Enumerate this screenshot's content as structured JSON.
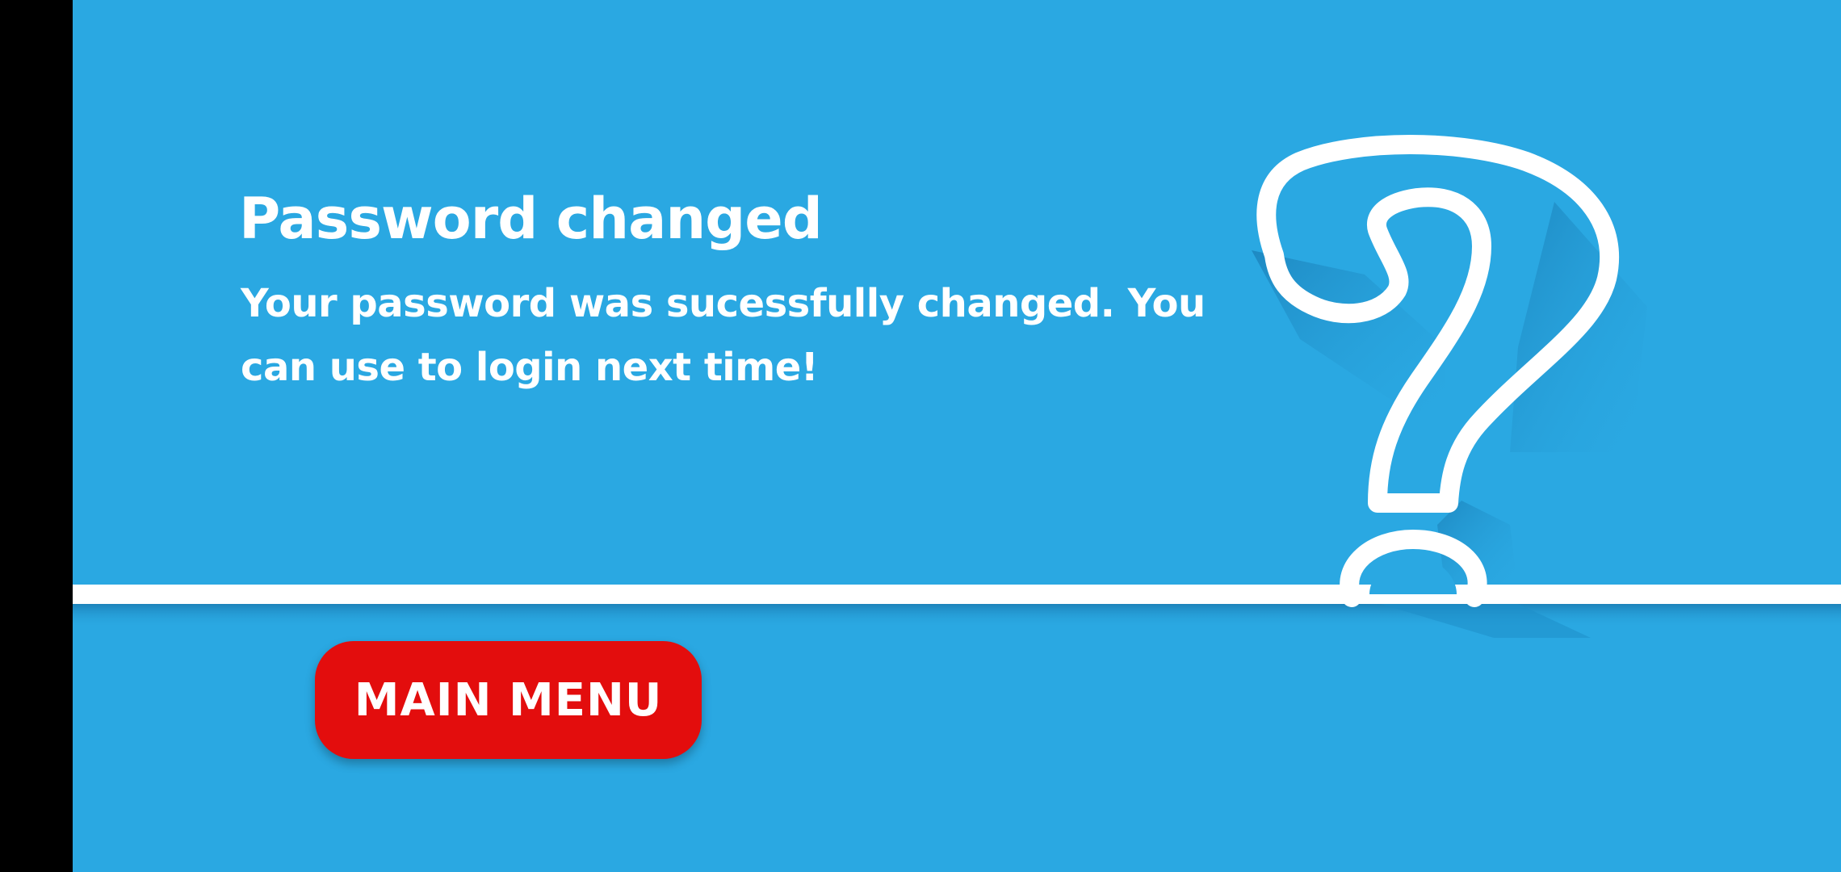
{
  "screen": {
    "title": "Password changed",
    "message": "Your password was sucessfully changed. You can use to login next time!",
    "main_menu_label": "MAIN MENU"
  },
  "colors": {
    "background": "#2aa8e2",
    "line": "#ffffff",
    "button": "#e30d0d",
    "text": "#ffffff",
    "left_bar": "#000000"
  },
  "icons": {
    "decoration": "question-mark-icon"
  }
}
